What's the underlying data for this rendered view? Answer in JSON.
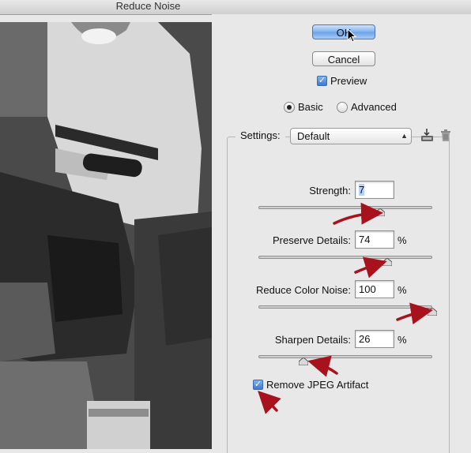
{
  "window": {
    "title": "Reduce Noise"
  },
  "buttons": {
    "ok": "OK",
    "cancel": "Cancel"
  },
  "preview_option": {
    "label": "Preview",
    "checked": true
  },
  "mode": {
    "basic": "Basic",
    "advanced": "Advanced",
    "selected": "Basic"
  },
  "settings": {
    "label": "Settings:",
    "value": "Default"
  },
  "icons": {
    "save": "save-preset-icon",
    "delete": "trash-icon",
    "dropdown": "up-down-arrows-icon"
  },
  "sliders": [
    {
      "label": "Strength:",
      "value": "7",
      "unit": "",
      "max": 10
    },
    {
      "label": "Preserve Details:",
      "value": "74",
      "unit": "%",
      "max": 100
    },
    {
      "label": "Reduce Color Noise:",
      "value": "100",
      "unit": "%",
      "max": 100
    },
    {
      "label": "Sharpen Details:",
      "value": "26",
      "unit": "%",
      "max": 100
    }
  ],
  "jpeg_option": {
    "label": "Remove JPEG Artifact",
    "checked": true
  },
  "colors": {
    "annotation_arrow": "#a8121c",
    "default_button": "#7fb1ee"
  }
}
